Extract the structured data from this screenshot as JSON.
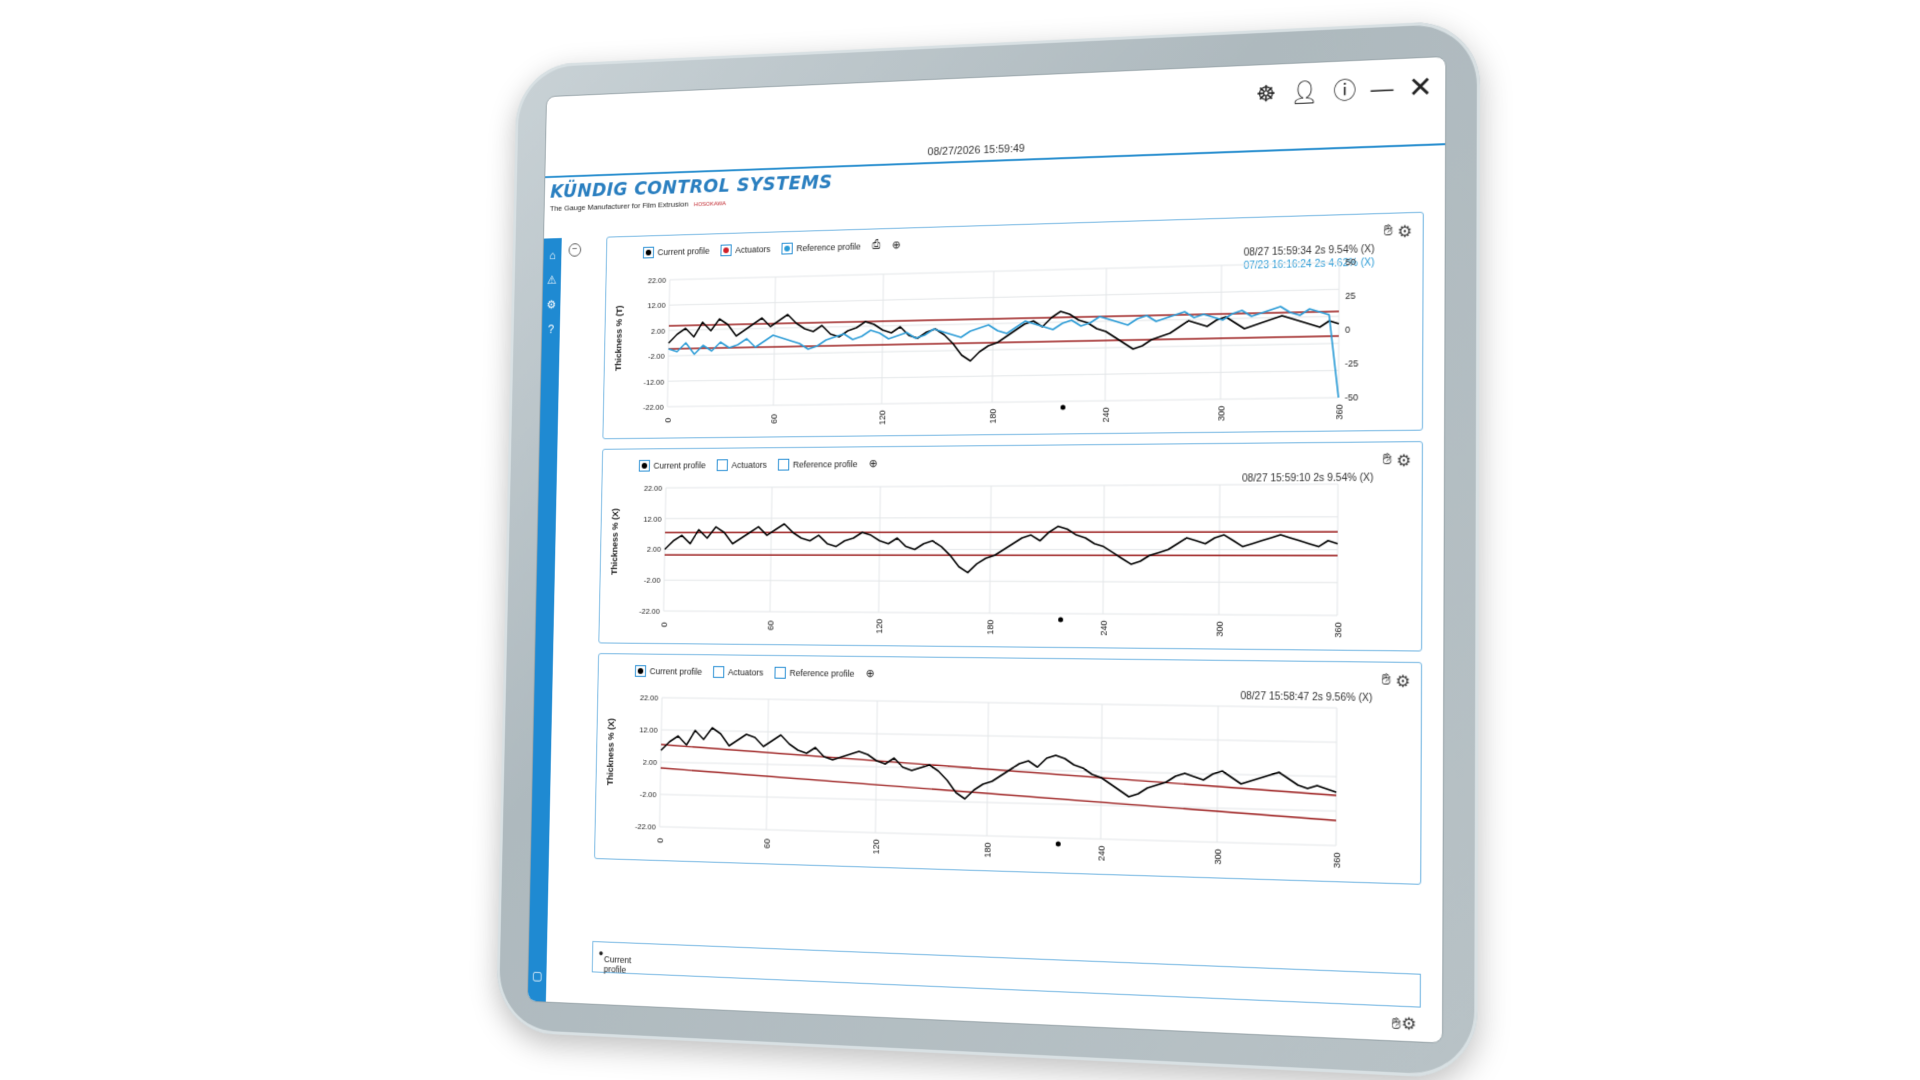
{
  "app": {
    "datetime": "08/27/2026 15:59:49",
    "logo_title": "KÜNDIG CONTROL SYSTEMS",
    "logo_tagline": "The Gauge Manufacturer for Film Extrusion",
    "logo_brand_mark": "HOSOKAWA"
  },
  "topbar": {
    "icons": [
      "steering-wheel-icon",
      "user-icon",
      "info-icon",
      "minimize-icon",
      "close-icon"
    ]
  },
  "sidebar": {
    "icons": [
      "home-icon",
      "warning-icon",
      "settings-icon",
      "help-icon",
      "export-icon"
    ]
  },
  "legend_labels": {
    "current": "Current profile",
    "actuators": "Actuators",
    "reference": "Reference profile"
  },
  "panels": [
    {
      "status_line": "08/27 15:59:34 2s 9.54% (X)",
      "reference_line": "07/23 16:16:24 2s 4.62% (X)",
      "ylabel": "Thickness % (T)"
    },
    {
      "status_line": "08/27 15:59:10 2s 9.54% (X)",
      "ylabel": "Thickness % (X)"
    },
    {
      "status_line": "08/27 15:58:47 2s 9.56% (X)",
      "ylabel": "Thickness % (X)"
    }
  ],
  "bottom_legend": "Current profile",
  "chart_data": [
    {
      "type": "line",
      "x_ticks": [
        "0",
        "60",
        "120",
        "180",
        "240",
        "300",
        "360"
      ],
      "y_ticks": [
        "22.00",
        "12.00",
        "2.00",
        "-2.00",
        "-12.00",
        "-22.00"
      ],
      "y2_ticks": [
        "50",
        "25",
        "0",
        "-25",
        "-50"
      ],
      "series": [
        {
          "name": "Current profile",
          "color": "#000000",
          "values": [
            0,
            3,
            5,
            2,
            7,
            4,
            8,
            6,
            2,
            4,
            6,
            8,
            5,
            7,
            9,
            6,
            4,
            3,
            5,
            2,
            1,
            3,
            4,
            6,
            5,
            3,
            2,
            4,
            1,
            0,
            2,
            3,
            1,
            -2,
            -6,
            -8,
            -5,
            -3,
            -2,
            0,
            2,
            4,
            5,
            3,
            6,
            8,
            7,
            5,
            4,
            2,
            1,
            -1,
            -3,
            -5,
            -4,
            -2,
            -1,
            0,
            2,
            4,
            3,
            2,
            4,
            5,
            3,
            1,
            2,
            3,
            4,
            5,
            4,
            3,
            2,
            1,
            3,
            2
          ]
        },
        {
          "name": "Reference profile",
          "color": "#2a9bd6",
          "values": [
            -2,
            -3,
            0,
            -4,
            -1,
            -3,
            0,
            -2,
            -1,
            1,
            -2,
            0,
            2,
            1,
            0,
            -1,
            -3,
            -2,
            0,
            1,
            2,
            0,
            1,
            3,
            2,
            0,
            1,
            2,
            0,
            1,
            3,
            2,
            1,
            0,
            2,
            3,
            4,
            2,
            1,
            3,
            5,
            4,
            3,
            2,
            4,
            5,
            3,
            4,
            6,
            5,
            4,
            3,
            5,
            6,
            4,
            5,
            6,
            7,
            5,
            6,
            5,
            4,
            6,
            7,
            5,
            6,
            7,
            8,
            6,
            5,
            7,
            6,
            5,
            -40
          ]
        }
      ]
    },
    {
      "type": "line",
      "x_ticks": [
        "0",
        "60",
        "120",
        "180",
        "240",
        "300",
        "360"
      ],
      "y_ticks": [
        "22.00",
        "12.00",
        "2.00",
        "-2.00",
        "-22.00"
      ],
      "series": [
        {
          "name": "Current profile",
          "color": "#000000",
          "values": [
            0,
            3,
            5,
            2,
            7,
            4,
            8,
            6,
            2,
            4,
            6,
            8,
            5,
            7,
            9,
            6,
            4,
            3,
            5,
            2,
            1,
            3,
            4,
            6,
            5,
            3,
            2,
            4,
            1,
            0,
            2,
            3,
            1,
            -2,
            -6,
            -8,
            -5,
            -3,
            -2,
            0,
            2,
            4,
            5,
            3,
            6,
            8,
            7,
            5,
            4,
            2,
            1,
            -1,
            -3,
            -5,
            -4,
            -2,
            -1,
            0,
            2,
            4,
            3,
            2,
            4,
            5,
            3,
            1,
            2,
            3,
            4,
            5,
            4,
            3,
            2,
            1,
            3,
            2
          ]
        }
      ]
    },
    {
      "type": "line",
      "x_ticks": [
        "0",
        "60",
        "120",
        "180",
        "240",
        "300",
        "360"
      ],
      "y_ticks": [
        "22.00",
        "12.00",
        "2.00",
        "-2.00",
        "-22.00"
      ],
      "series": [
        {
          "name": "Current profile",
          "color": "#000000",
          "values": [
            4,
            7,
            9,
            6,
            11,
            8,
            12,
            10,
            6,
            8,
            10,
            9,
            6,
            8,
            10,
            7,
            5,
            4,
            6,
            3,
            2,
            3,
            4,
            5,
            4,
            2,
            1,
            3,
            0,
            -1,
            0,
            1,
            -1,
            -4,
            -8,
            -10,
            -7,
            -5,
            -4,
            -2,
            0,
            2,
            3,
            1,
            4,
            5,
            4,
            2,
            1,
            -1,
            -2,
            -4,
            -6,
            -8,
            -7,
            -5,
            -4,
            -3,
            -1,
            0,
            -1,
            -2,
            0,
            1,
            -1,
            -3,
            -2,
            -1,
            0,
            1,
            -1,
            -3,
            -4,
            -3,
            -4,
            -5
          ]
        }
      ]
    }
  ]
}
